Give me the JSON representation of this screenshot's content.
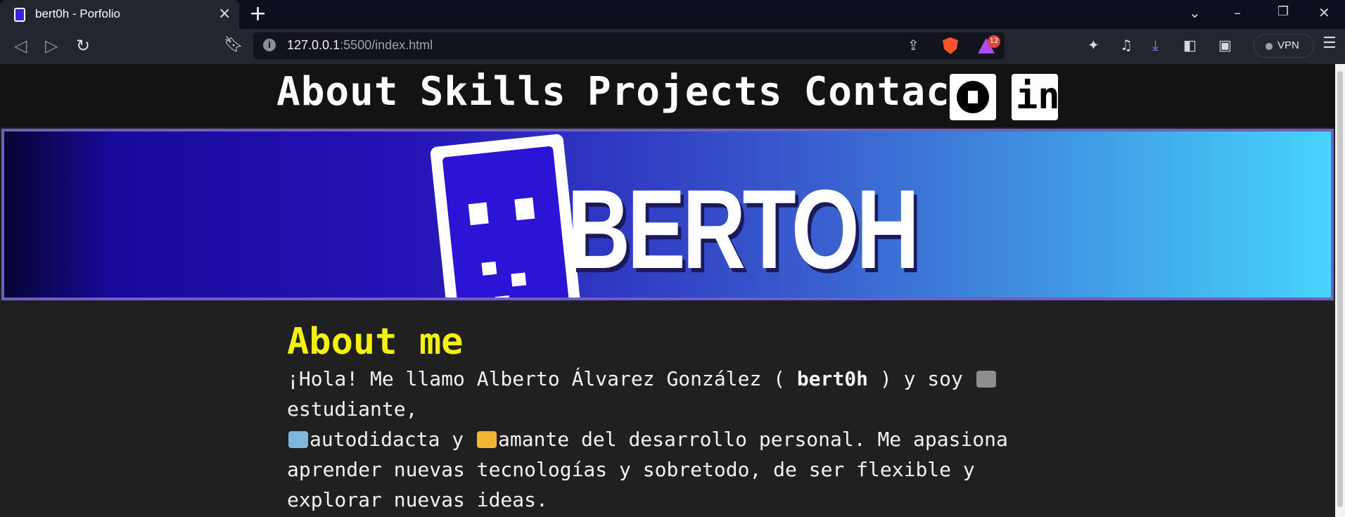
{
  "browser": {
    "tab_title": "bert0h - Porfolio",
    "tab_close": "×",
    "new_tab": "+",
    "url_host": "127.0.0.1",
    "url_rest": ":5500/index.html",
    "rewards_count": "12",
    "vpn_label": "VPN"
  },
  "nav": {
    "links": [
      "About",
      "Skills",
      "Projects",
      "Contact"
    ],
    "linkedin_label": "in"
  },
  "banner": {
    "brand": "BERTOH"
  },
  "about": {
    "title": "About me",
    "intro_before": "¡Hola! Me llamo Alberto Álvarez González ( ",
    "handle": "bert0h",
    "intro_after": " ) y soy ",
    "student": "estudiante,",
    "self_taught": "autodidacta y ",
    "lover": "amante del desarrollo personal. Me apasiona aprender nuevas tecnologías y sobretodo, de ser flexible y explorar nuevas ideas."
  },
  "colors": {
    "accent_title": "#f5f10f",
    "banner_start": "#060433",
    "banner_end": "#46d4fb",
    "brave": "#fb542b"
  },
  "icons": [
    "back-icon",
    "forward-icon",
    "reload-icon",
    "bookmark-icon",
    "info-icon",
    "share-icon",
    "brave-shields-icon",
    "brave-rewards-icon",
    "extensions-icon",
    "media-icon",
    "download-icon",
    "sidebar-icon",
    "wallet-icon",
    "menu-icon",
    "github-icon",
    "linkedin-icon",
    "graduation-cap-icon",
    "technologist-icon",
    "flexed-biceps-icon"
  ]
}
